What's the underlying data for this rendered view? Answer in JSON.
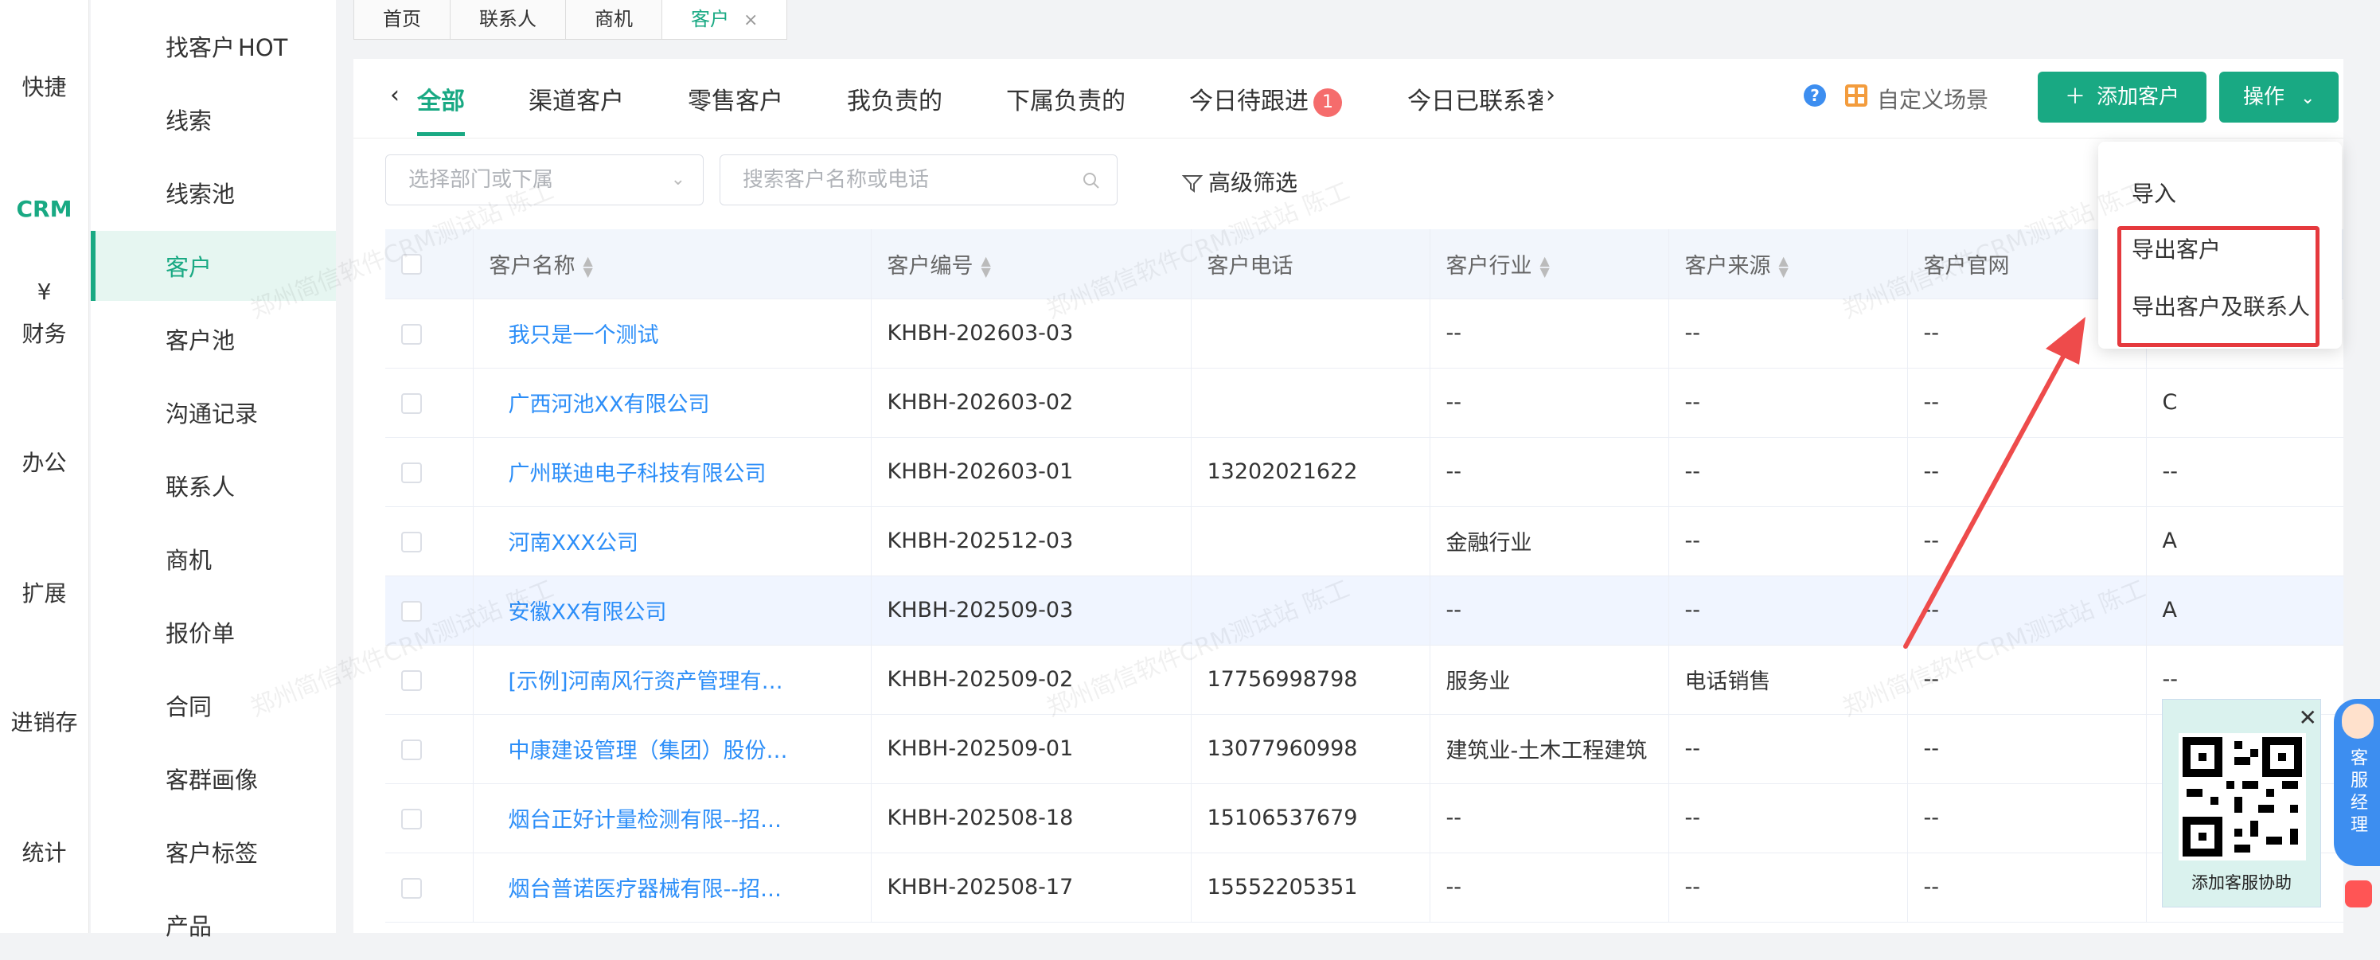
{
  "rail": [
    {
      "label": "快捷",
      "icon": "home-icon"
    },
    {
      "label": "CRM",
      "icon": "crm-icon",
      "active": true
    },
    {
      "label": "财务",
      "icon": "finance-icon"
    },
    {
      "label": "办公",
      "icon": "monitor-icon"
    },
    {
      "label": "扩展",
      "icon": "extend-icon"
    },
    {
      "label": "进销存",
      "icon": "warehouse-icon"
    },
    {
      "label": "统计",
      "icon": "stats-icon"
    }
  ],
  "nav": [
    {
      "label": "找客户",
      "icon": "find-customer-icon",
      "hot": "HOT"
    },
    {
      "label": "线索",
      "icon": "clue-icon"
    },
    {
      "label": "线索池",
      "icon": "clue-pool-icon"
    },
    {
      "label": "客户",
      "icon": "customer-icon",
      "active": true
    },
    {
      "label": "客户池",
      "icon": "customer-pool-icon"
    },
    {
      "label": "沟通记录",
      "icon": "record-icon"
    },
    {
      "label": "联系人",
      "icon": "contact-icon"
    },
    {
      "label": "商机",
      "icon": "opportunity-icon"
    },
    {
      "label": "报价单",
      "icon": "quote-icon"
    },
    {
      "label": "合同",
      "icon": "contract-icon"
    },
    {
      "label": "客群画像",
      "icon": "portrait-icon"
    },
    {
      "label": "客户标签",
      "icon": "tag-icon"
    },
    {
      "label": "产品",
      "icon": "product-icon"
    }
  ],
  "tabs": [
    {
      "label": "首页"
    },
    {
      "label": "联系人"
    },
    {
      "label": "商机"
    },
    {
      "label": "客户",
      "active": true,
      "close": "×"
    }
  ],
  "scene": {
    "tabs": [
      "全部",
      "渠道客户",
      "零售客户",
      "我负责的",
      "下属负责的",
      "今日待跟进",
      "今日已联系客户"
    ],
    "badge": "1",
    "custom_label": "自定义场景",
    "add_button": "添加客户",
    "op_button": "操作"
  },
  "filters": {
    "dept_placeholder": "选择部门或下属",
    "search_placeholder": "搜索客户名称或电话",
    "advanced": "高级筛选"
  },
  "table": {
    "headers": [
      "客户名称",
      "客户编号",
      "客户电话",
      "客户行业",
      "客户来源",
      "客户官网",
      ""
    ],
    "rows": [
      {
        "name": "我只是一个测试",
        "flag": "off",
        "bulb": false,
        "code": "KHBH-202603-03",
        "phone": "",
        "industry": "--",
        "source": "--",
        "site": "--",
        "level": ""
      },
      {
        "name": "广西河池XX有限公司",
        "flag": "off",
        "bulb": false,
        "code": "KHBH-202603-02",
        "phone": "",
        "industry": "--",
        "source": "--",
        "site": "--",
        "level": "C"
      },
      {
        "name": "广州联迪电子科技有限公司",
        "flag": "on",
        "bulb": true,
        "code": "KHBH-202603-01",
        "phone": "13202021622",
        "industry": "--",
        "source": "--",
        "site": "--",
        "level": "--"
      },
      {
        "name": "河南XXX公司",
        "flag": "on",
        "bulb": true,
        "code": "KHBH-202512-03",
        "phone": "",
        "industry": "金融行业",
        "source": "--",
        "site": "--",
        "level": "A"
      },
      {
        "name": "安徽XX有限公司",
        "flag": "on",
        "bulb": true,
        "code": "KHBH-202509-03",
        "phone": "",
        "industry": "--",
        "source": "--",
        "site": "--",
        "level": "A",
        "hl": true
      },
      {
        "name": "[示例]河南风行资产管理有限公司",
        "flag": "off",
        "bulb": true,
        "code": "KHBH-202509-02",
        "phone": "17756998798",
        "industry": "服务业",
        "source": "电话销售",
        "site": "--",
        "level": "--"
      },
      {
        "name": "中康建设管理（集团）股份有限公司",
        "flag": "off",
        "bulb": false,
        "code": "KHBH-202509-01",
        "phone": "13077960998",
        "industry": "建筑业-土木工程建筑",
        "source": "--",
        "site": "--",
        "level": ""
      },
      {
        "name": "烟台正好计量检测有限--招商部",
        "flag": "off",
        "bulb": false,
        "code": "KHBH-202508-18",
        "phone": "15106537679",
        "industry": "--",
        "source": "--",
        "site": "--",
        "level": ""
      },
      {
        "name": "烟台普诺医疗器械有限--招商部",
        "flag": "off",
        "bulb": false,
        "code": "KHBH-202508-17",
        "phone": "15552205351",
        "industry": "--",
        "source": "--",
        "site": "--",
        "level": ""
      }
    ]
  },
  "dropdown": {
    "items": [
      "导入",
      "导出客户",
      "导出客户及联系人"
    ]
  },
  "qr": {
    "title": "添加客服协助",
    "close": "✕"
  },
  "service": {
    "label": "客服经理"
  },
  "watermark": "郑州简信软件CRM测试站 陈工",
  "colors": {
    "accent": "#19a983",
    "link": "#2c8ef8",
    "highlight_box": "#e5393d"
  }
}
